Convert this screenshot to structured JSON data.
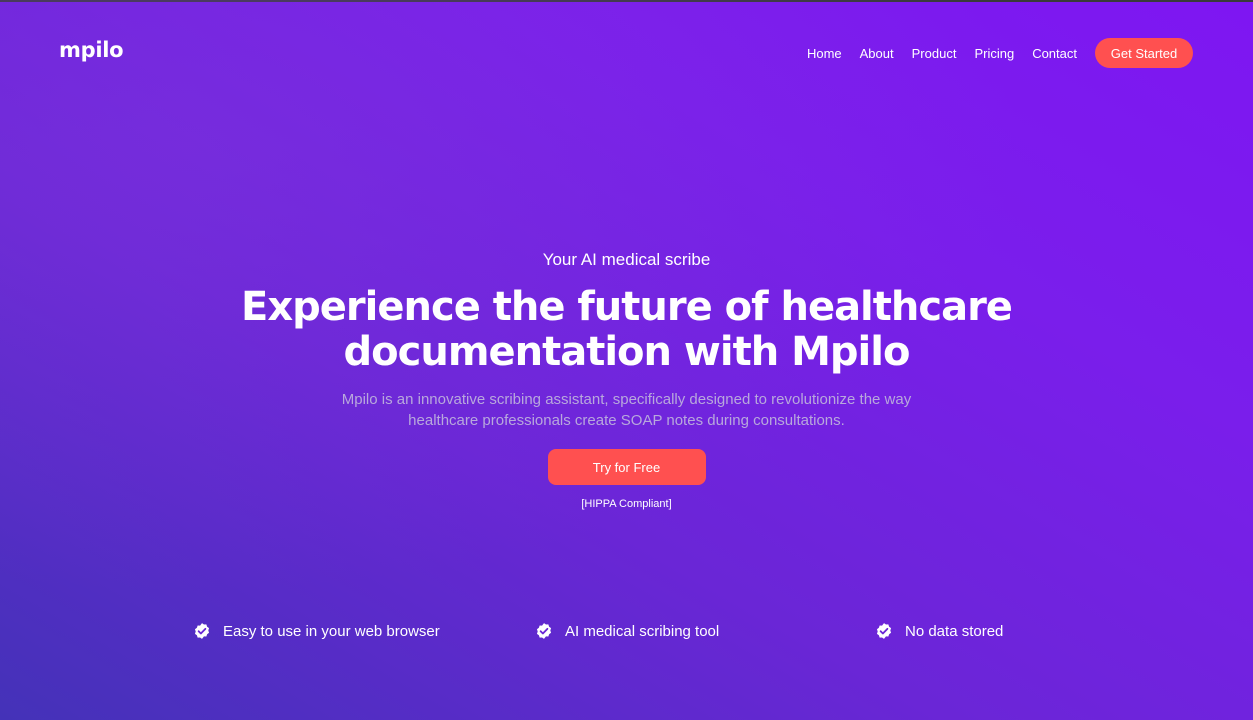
{
  "header": {
    "logo": "mpilo",
    "nav": [
      {
        "label": "Home"
      },
      {
        "label": "About"
      },
      {
        "label": "Product"
      },
      {
        "label": "Pricing"
      },
      {
        "label": "Contact"
      }
    ],
    "cta_label": "Get Started"
  },
  "hero": {
    "eyebrow": "Your AI medical scribe",
    "headline": "Experience the future of healthcare documentation with Mpilo",
    "description": "Mpilo is an innovative scribing assistant, specifically designed to revolutionize the way healthcare professionals create SOAP notes during consultations.",
    "cta_label": "Try for Free",
    "compliance": "[HIPPA Compliant]"
  },
  "features": [
    {
      "label": "Easy to use in your web browser",
      "icon": "check-badge-icon"
    },
    {
      "label": "AI medical scribing tool",
      "icon": "check-badge-icon"
    },
    {
      "label": "No data stored",
      "icon": "check-badge-icon"
    }
  ],
  "colors": {
    "accent": "#ff5050",
    "gradient_start": "#4432b8",
    "gradient_end": "#7e16f2",
    "muted_text": "#b8a8dc"
  }
}
